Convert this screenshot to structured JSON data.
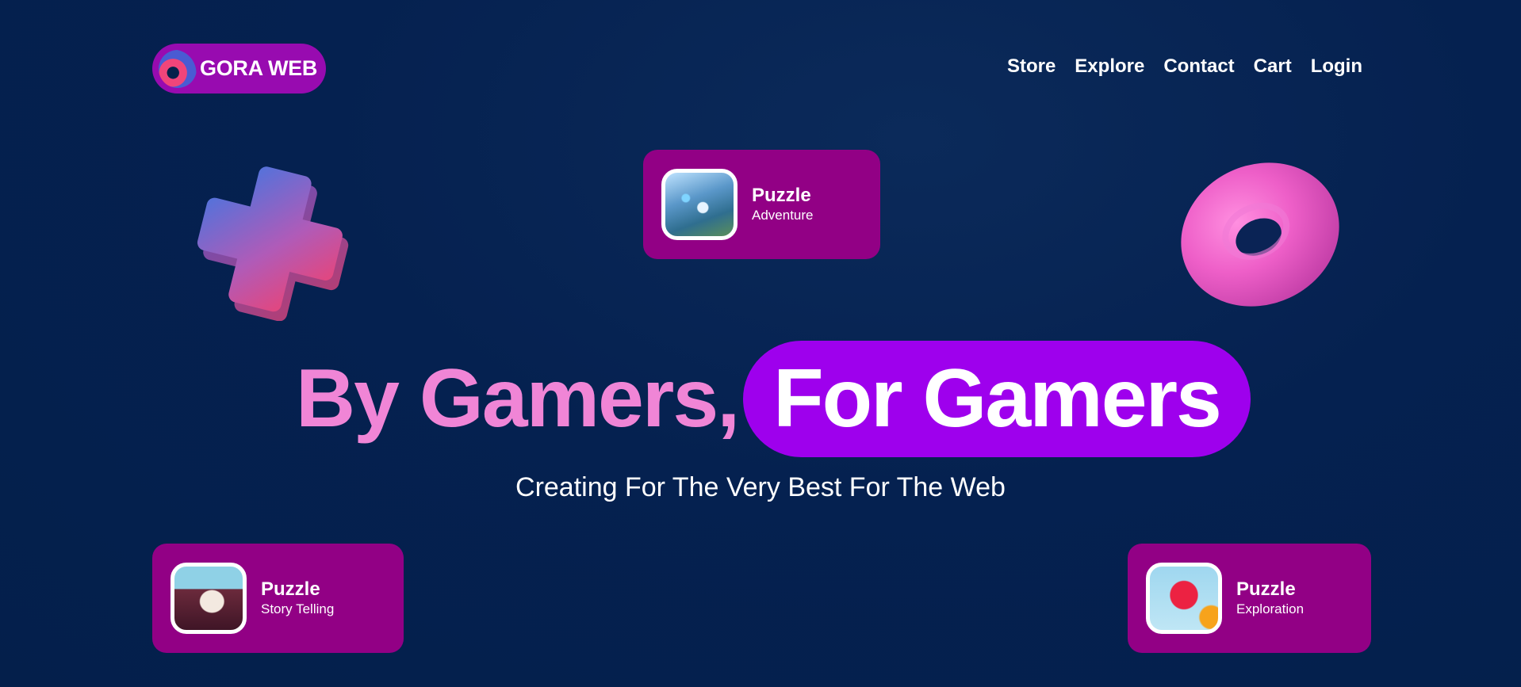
{
  "brand": {
    "name": "GORA WEB",
    "logo_icon": "ring-icon"
  },
  "nav": {
    "items": [
      "Store",
      "Explore",
      "Contact",
      "Cart",
      "Login"
    ]
  },
  "cards": {
    "top": {
      "title": "Puzzle",
      "subtitle": "Adventure",
      "image": "wolf-game-thumbnail"
    },
    "bottom_left": {
      "title": "Puzzle",
      "subtitle": "Story Telling",
      "image": "car-game-thumbnail"
    },
    "bottom_right": {
      "title": "Puzzle",
      "subtitle": "Exploration",
      "image": "octopus-game-thumbnail"
    }
  },
  "hero": {
    "headline_part1": "By Gamers,",
    "headline_part2": "For Gamers",
    "subtitle": "Creating For The Very Best For The Web"
  },
  "colors": {
    "background": "#041f4b",
    "accent_magenta": "#920085",
    "accent_purple": "#9e00ed",
    "headline_pink": "#f085d6"
  },
  "decorations": [
    "plus-3d-icon",
    "torus-3d-icon"
  ]
}
